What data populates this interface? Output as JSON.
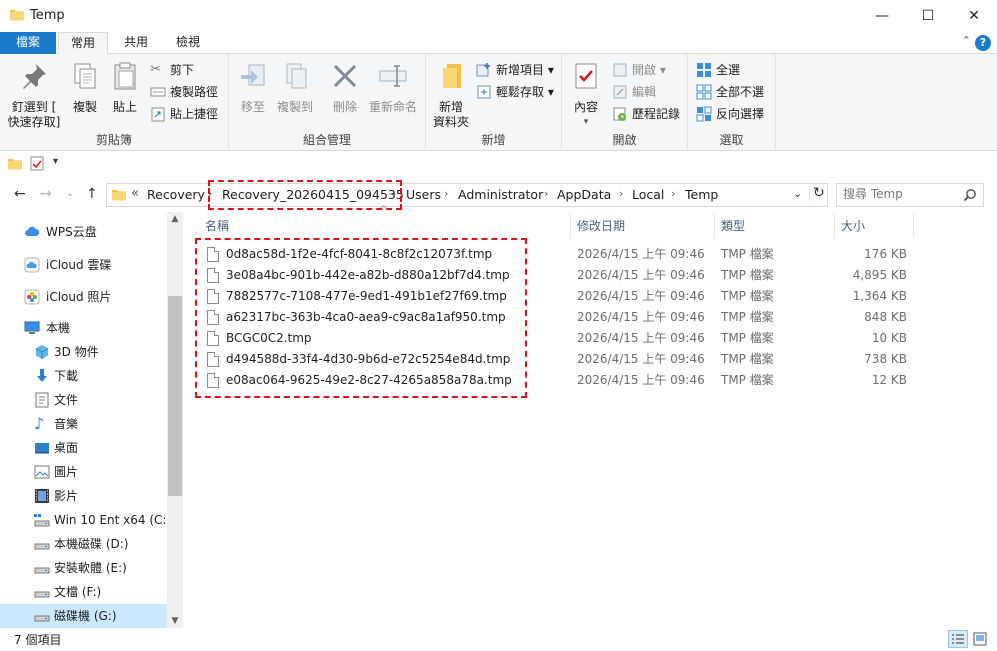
{
  "window": {
    "title": "Temp",
    "minimize": "—",
    "maximize": "☐",
    "close": "✕"
  },
  "ribbon_tabs": [
    {
      "label": "檔案"
    },
    {
      "label": "常用"
    },
    {
      "label": "共用"
    },
    {
      "label": "檢視"
    }
  ],
  "help_label": "?",
  "ribbon": {
    "clipboard": {
      "group_label": "剪貼簿",
      "pin_line1": "釘選到 [",
      "pin_line2": "快速存取]",
      "copy": "複製",
      "paste": "貼上",
      "cut": "剪下",
      "copy_path": "複製路徑",
      "paste_shortcut": "貼上捷徑"
    },
    "organize": {
      "group_label": "組合管理",
      "move_to": "移至",
      "copy_to": "複製到",
      "delete": "刪除",
      "rename": "重新命名"
    },
    "new": {
      "group_label": "新增",
      "new_folder_line1": "新增",
      "new_folder_line2": "資料夾",
      "new_item": "新增項目 ▾",
      "easy_access": "輕鬆存取 ▾"
    },
    "open": {
      "group_label": "開啟",
      "properties": "內容",
      "open": "開啟 ▾",
      "edit": "編輯",
      "history": "歷程記錄"
    },
    "select": {
      "group_label": "選取",
      "select_all": "全選",
      "select_none": "全部不選",
      "invert": "反向選擇"
    }
  },
  "address": {
    "overflow": "«",
    "crumbs": [
      "Recovery",
      "Recovery_20260415_094535",
      "Users",
      "Administrator",
      "AppData",
      "Local",
      "Temp"
    ],
    "search_placeholder": "搜尋 Temp"
  },
  "nav_pane": [
    {
      "label": "WPS云盘",
      "icon": "cloud-icon"
    },
    {
      "label": "iCloud 雲碟",
      "icon": "icloud-drive-icon"
    },
    {
      "label": "iCloud 照片",
      "icon": "icloud-photos-icon"
    },
    {
      "label": "本機",
      "icon": "computer-icon"
    },
    {
      "label": "3D 物件",
      "icon": "3d-objects-icon"
    },
    {
      "label": "下載",
      "icon": "downloads-icon"
    },
    {
      "label": "文件",
      "icon": "documents-icon"
    },
    {
      "label": "音樂",
      "icon": "music-icon"
    },
    {
      "label": "桌面",
      "icon": "desktop-icon"
    },
    {
      "label": "圖片",
      "icon": "pictures-icon"
    },
    {
      "label": "影片",
      "icon": "videos-icon"
    },
    {
      "label": "Win 10 Ent x64 (C:)",
      "icon": "system-drive-icon"
    },
    {
      "label": "本機磁碟 (D:)",
      "icon": "drive-icon"
    },
    {
      "label": "安裝軟體 (E:)",
      "icon": "drive-icon"
    },
    {
      "label": "文檔 (F:)",
      "icon": "drive-icon"
    },
    {
      "label": "磁碟機 (G:)",
      "icon": "drive-icon"
    }
  ],
  "columns": {
    "name": "名稱",
    "date": "修改日期",
    "type": "類型",
    "size": "大小",
    "sort_indicator": "^"
  },
  "files": [
    {
      "name": "0d8ac58d-1f2e-4fcf-8041-8c8f2c12073f.tmp",
      "date": "2026/4/15 上午 09:46",
      "type": "TMP 檔案",
      "size": "176 KB"
    },
    {
      "name": "3e08a4bc-901b-442e-a82b-d880a12bf7d4.tmp",
      "date": "2026/4/15 上午 09:46",
      "type": "TMP 檔案",
      "size": "4,895 KB"
    },
    {
      "name": "7882577c-7108-477e-9ed1-491b1ef27f69.tmp",
      "date": "2026/4/15 上午 09:46",
      "type": "TMP 檔案",
      "size": "1,364 KB"
    },
    {
      "name": "a62317bc-363b-4ca0-aea9-c9ac8a1af950.tmp",
      "date": "2026/4/15 上午 09:46",
      "type": "TMP 檔案",
      "size": "848 KB"
    },
    {
      "name": "BCGC0C2.tmp",
      "date": "2026/4/15 上午 09:46",
      "type": "TMP 檔案",
      "size": "10 KB"
    },
    {
      "name": "d494588d-33f4-4d30-9b6d-e72c5254e84d.tmp",
      "date": "2026/4/15 上午 09:46",
      "type": "TMP 檔案",
      "size": "738 KB"
    },
    {
      "name": "e08ac064-9625-49e2-8c27-4265a858a78a.tmp",
      "date": "2026/4/15 上午 09:46",
      "type": "TMP 檔案",
      "size": "12 KB"
    }
  ],
  "status": {
    "item_count": "7 個項目"
  },
  "colors": {
    "accent": "#1979ca",
    "highlight": "#d9141f",
    "selection": "#cce8ff"
  }
}
